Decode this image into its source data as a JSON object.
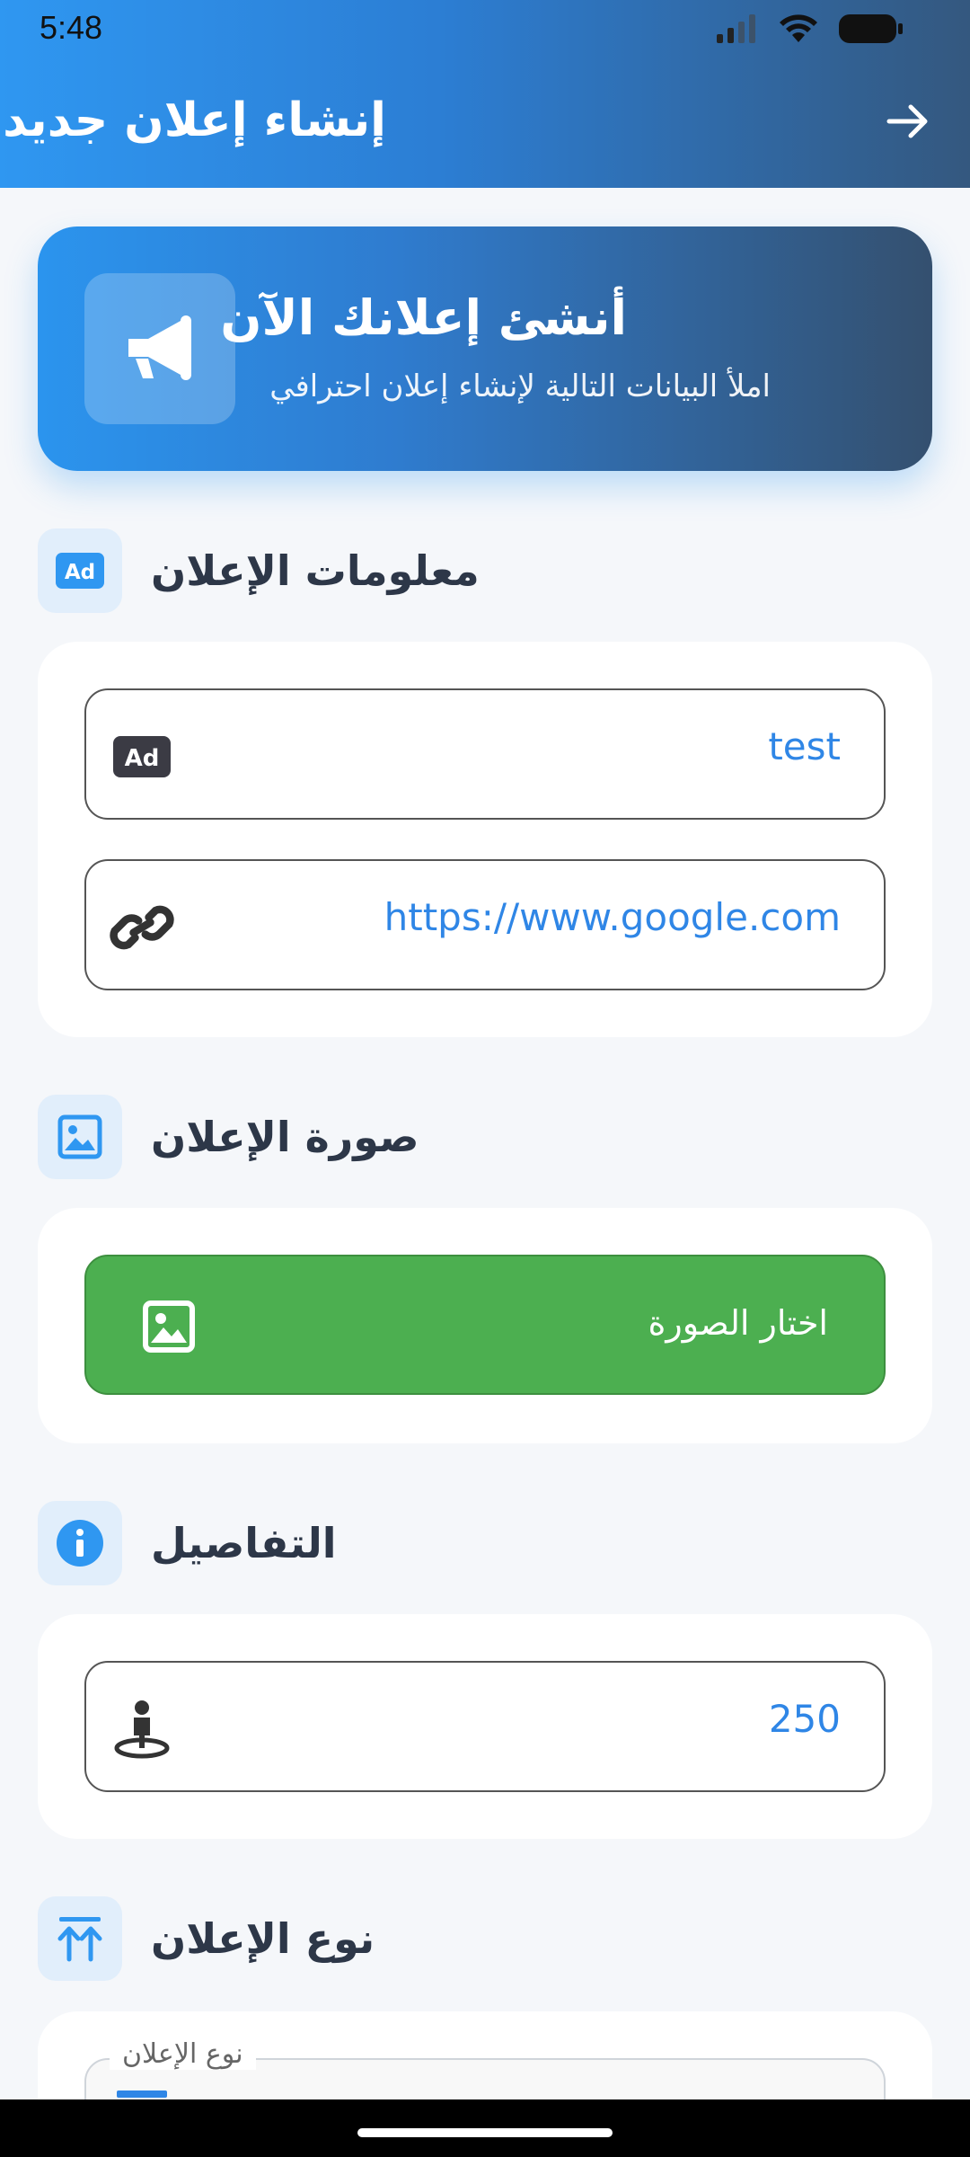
{
  "status_bar": {
    "time": "5:48"
  },
  "header": {
    "title": "إنشاء إعلان جديد",
    "back_icon": "arrow-right-icon"
  },
  "hero": {
    "title": "أنشئ إعلانك الآن",
    "subtitle": "املأ البيانات التالية لإنشاء إعلان احترافي",
    "icon": "megaphone-icon"
  },
  "sections": {
    "ad_info": {
      "title": "معلومات الإعلان",
      "icon": "ad-icon",
      "fields": {
        "title_value": "test",
        "title_icon": "ad-icon",
        "link_value": "https://www.google.com",
        "link_icon": "link-icon"
      }
    },
    "ad_image": {
      "title": "صورة الإعلان",
      "icon": "image-icon",
      "button_label": "اختار الصورة",
      "button_icon": "image-icon"
    },
    "details": {
      "title": "التفاصيل",
      "icon": "info-icon",
      "fields": {
        "count_value": "250",
        "count_icon": "person-pin-icon"
      }
    },
    "ad_type": {
      "title": "نوع الإعلان",
      "icon": "double-arrow-up-icon",
      "select_label": "نوع الإعلان"
    }
  },
  "colors": {
    "primary": "#2f97f1",
    "primary_dark": "#34587f",
    "button_green": "#4caf50",
    "value_blue": "#2f86e6",
    "heading": "#2d3748"
  }
}
